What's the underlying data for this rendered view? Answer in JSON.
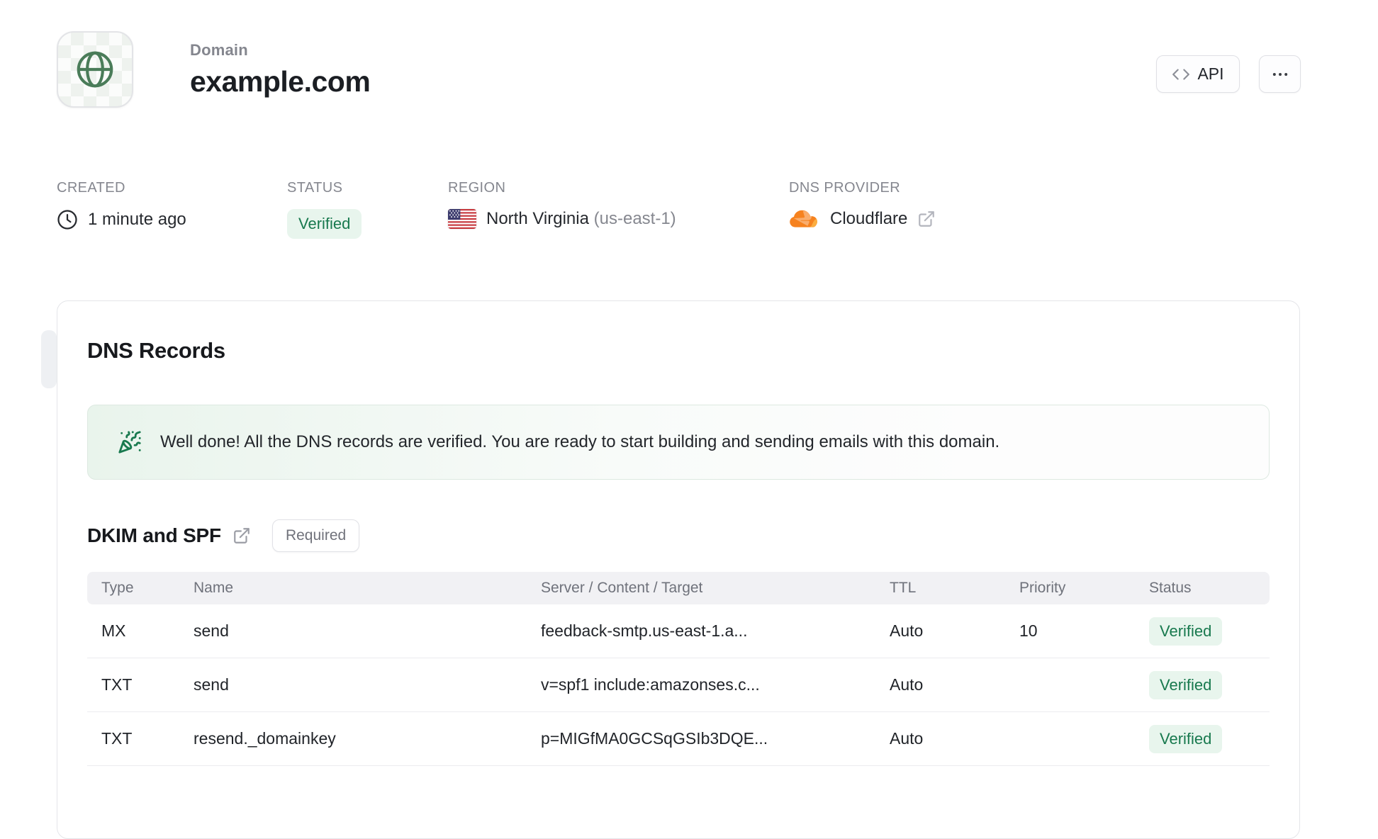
{
  "header": {
    "eyebrow": "Domain",
    "title": "example.com",
    "api_button_label": "API"
  },
  "meta": {
    "created": {
      "label": "CREATED",
      "value": "1 minute ago"
    },
    "status": {
      "label": "STATUS",
      "value": "Verified"
    },
    "region": {
      "label": "REGION",
      "value": "North Virginia",
      "code": "(us-east-1)"
    },
    "dns_provider": {
      "label": "DNS PROVIDER",
      "value": "Cloudflare"
    }
  },
  "dns_card": {
    "title": "DNS Records",
    "banner_text": "Well done! All the DNS records are verified. You are ready to start building and sending emails with this domain.",
    "section_title": "DKIM and SPF",
    "section_badge": "Required",
    "table": {
      "headers": [
        "Type",
        "Name",
        "Server / Content / Target",
        "TTL",
        "Priority",
        "Status"
      ],
      "rows": [
        {
          "type": "MX",
          "name": "send",
          "content": "feedback-smtp.us-east-1.a...",
          "ttl": "Auto",
          "priority": "10",
          "status": "Verified"
        },
        {
          "type": "TXT",
          "name": "send",
          "content": "v=spf1 include:amazonses.c...",
          "ttl": "Auto",
          "priority": "",
          "status": "Verified"
        },
        {
          "type": "TXT",
          "name": "resend._domainkey",
          "content": "p=MIGfMA0GCSqGSIb3DQE...",
          "ttl": "Auto",
          "priority": "",
          "status": "Verified"
        }
      ]
    }
  },
  "icons": {
    "tile": "globe-icon",
    "api": "code-icon",
    "more": "ellipsis-icon",
    "created": "clock-icon",
    "region": "us-flag-icon",
    "dns_provider": "cloudflare-icon",
    "external": "external-link-icon",
    "banner": "party-popper-icon"
  },
  "colors": {
    "accent_green": "#18794e",
    "verified_badge_bg": "#e8f5ed",
    "banner_green": "#e9f4ec",
    "cloudflare_orange": "#f6821f",
    "border_gray": "#e4e5e9",
    "label_gray": "#85878f",
    "text_dark": "#1b1e23"
  }
}
